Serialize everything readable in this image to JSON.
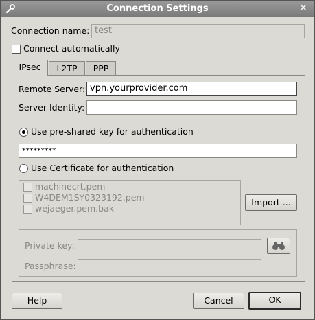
{
  "window": {
    "title": "Connection Settings"
  },
  "connection": {
    "name_label": "Connection name:",
    "name_value": "test"
  },
  "connect_auto": {
    "label": "Connect automatically",
    "checked": false
  },
  "tabs": [
    {
      "label": "IPsec",
      "active": true
    },
    {
      "label": "L2TP",
      "active": false
    },
    {
      "label": "PPP",
      "active": false
    }
  ],
  "ipsec": {
    "remote_server_label": "Remote Server:",
    "remote_server_value": "vpn.yourprovider.com",
    "server_identity_label": "Server Identity:",
    "server_identity_value": "",
    "psk_radio_label": "Use pre-shared key for authentication",
    "psk_value": "*********",
    "cert_radio_label": "Use Certificate for authentication",
    "certificates": [
      {
        "name": "machinecrt.pem",
        "checked": false
      },
      {
        "name": "W4DEM1SY0323192.pem",
        "checked": false
      },
      {
        "name": "wejaeger.pem.bak",
        "checked": false
      }
    ],
    "import_label": "Import ...",
    "private_key_label": "Private key:",
    "passphrase_label": "Passphrase:"
  },
  "buttons": {
    "help": "Help",
    "cancel": "Cancel",
    "ok": "OK"
  }
}
